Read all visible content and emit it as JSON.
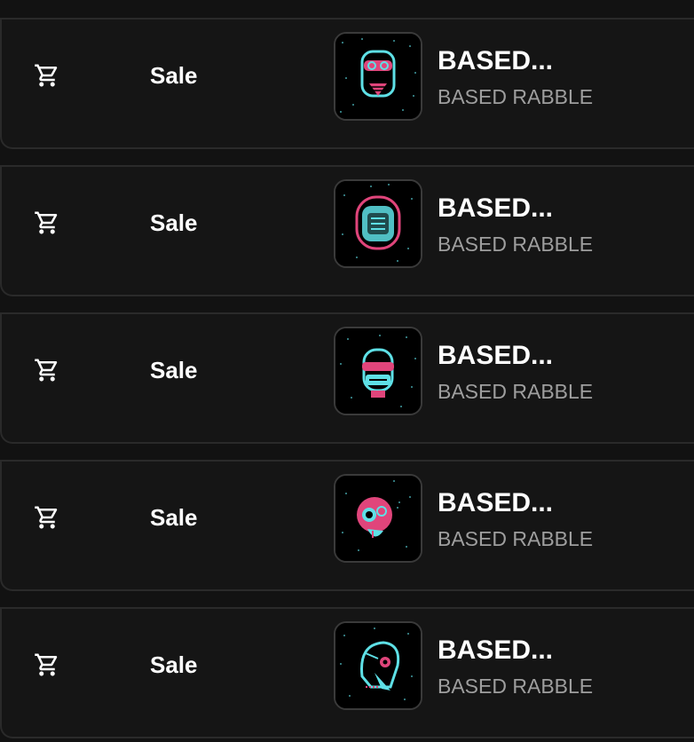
{
  "rows": [
    {
      "event": "Sale",
      "event_icon": "cart-icon",
      "title": "BASED...",
      "collection": "BASED RABBLE",
      "art_accent": "#e0457b",
      "art_main": "#5ee0e6"
    },
    {
      "event": "Sale",
      "event_icon": "cart-icon",
      "title": "BASED...",
      "collection": "BASED RABBLE",
      "art_accent": "#e0457b",
      "art_main": "#5ee0e6"
    },
    {
      "event": "Sale",
      "event_icon": "cart-icon",
      "title": "BASED...",
      "collection": "BASED RABBLE",
      "art_accent": "#e0457b",
      "art_main": "#5ee0e6"
    },
    {
      "event": "Sale",
      "event_icon": "cart-icon",
      "title": "BASED...",
      "collection": "BASED RABBLE",
      "art_accent": "#e0457b",
      "art_main": "#5ee0e6"
    },
    {
      "event": "Sale",
      "event_icon": "cart-icon",
      "title": "BASED...",
      "collection": "BASED RABBLE",
      "art_accent": "#e0457b",
      "art_main": "#5ee0e6"
    }
  ],
  "colors": {
    "background": "#121212",
    "row_background": "#151515",
    "border": "#2a2a2a",
    "primary_text": "#ffffff",
    "secondary_text": "#9e9e9e"
  }
}
